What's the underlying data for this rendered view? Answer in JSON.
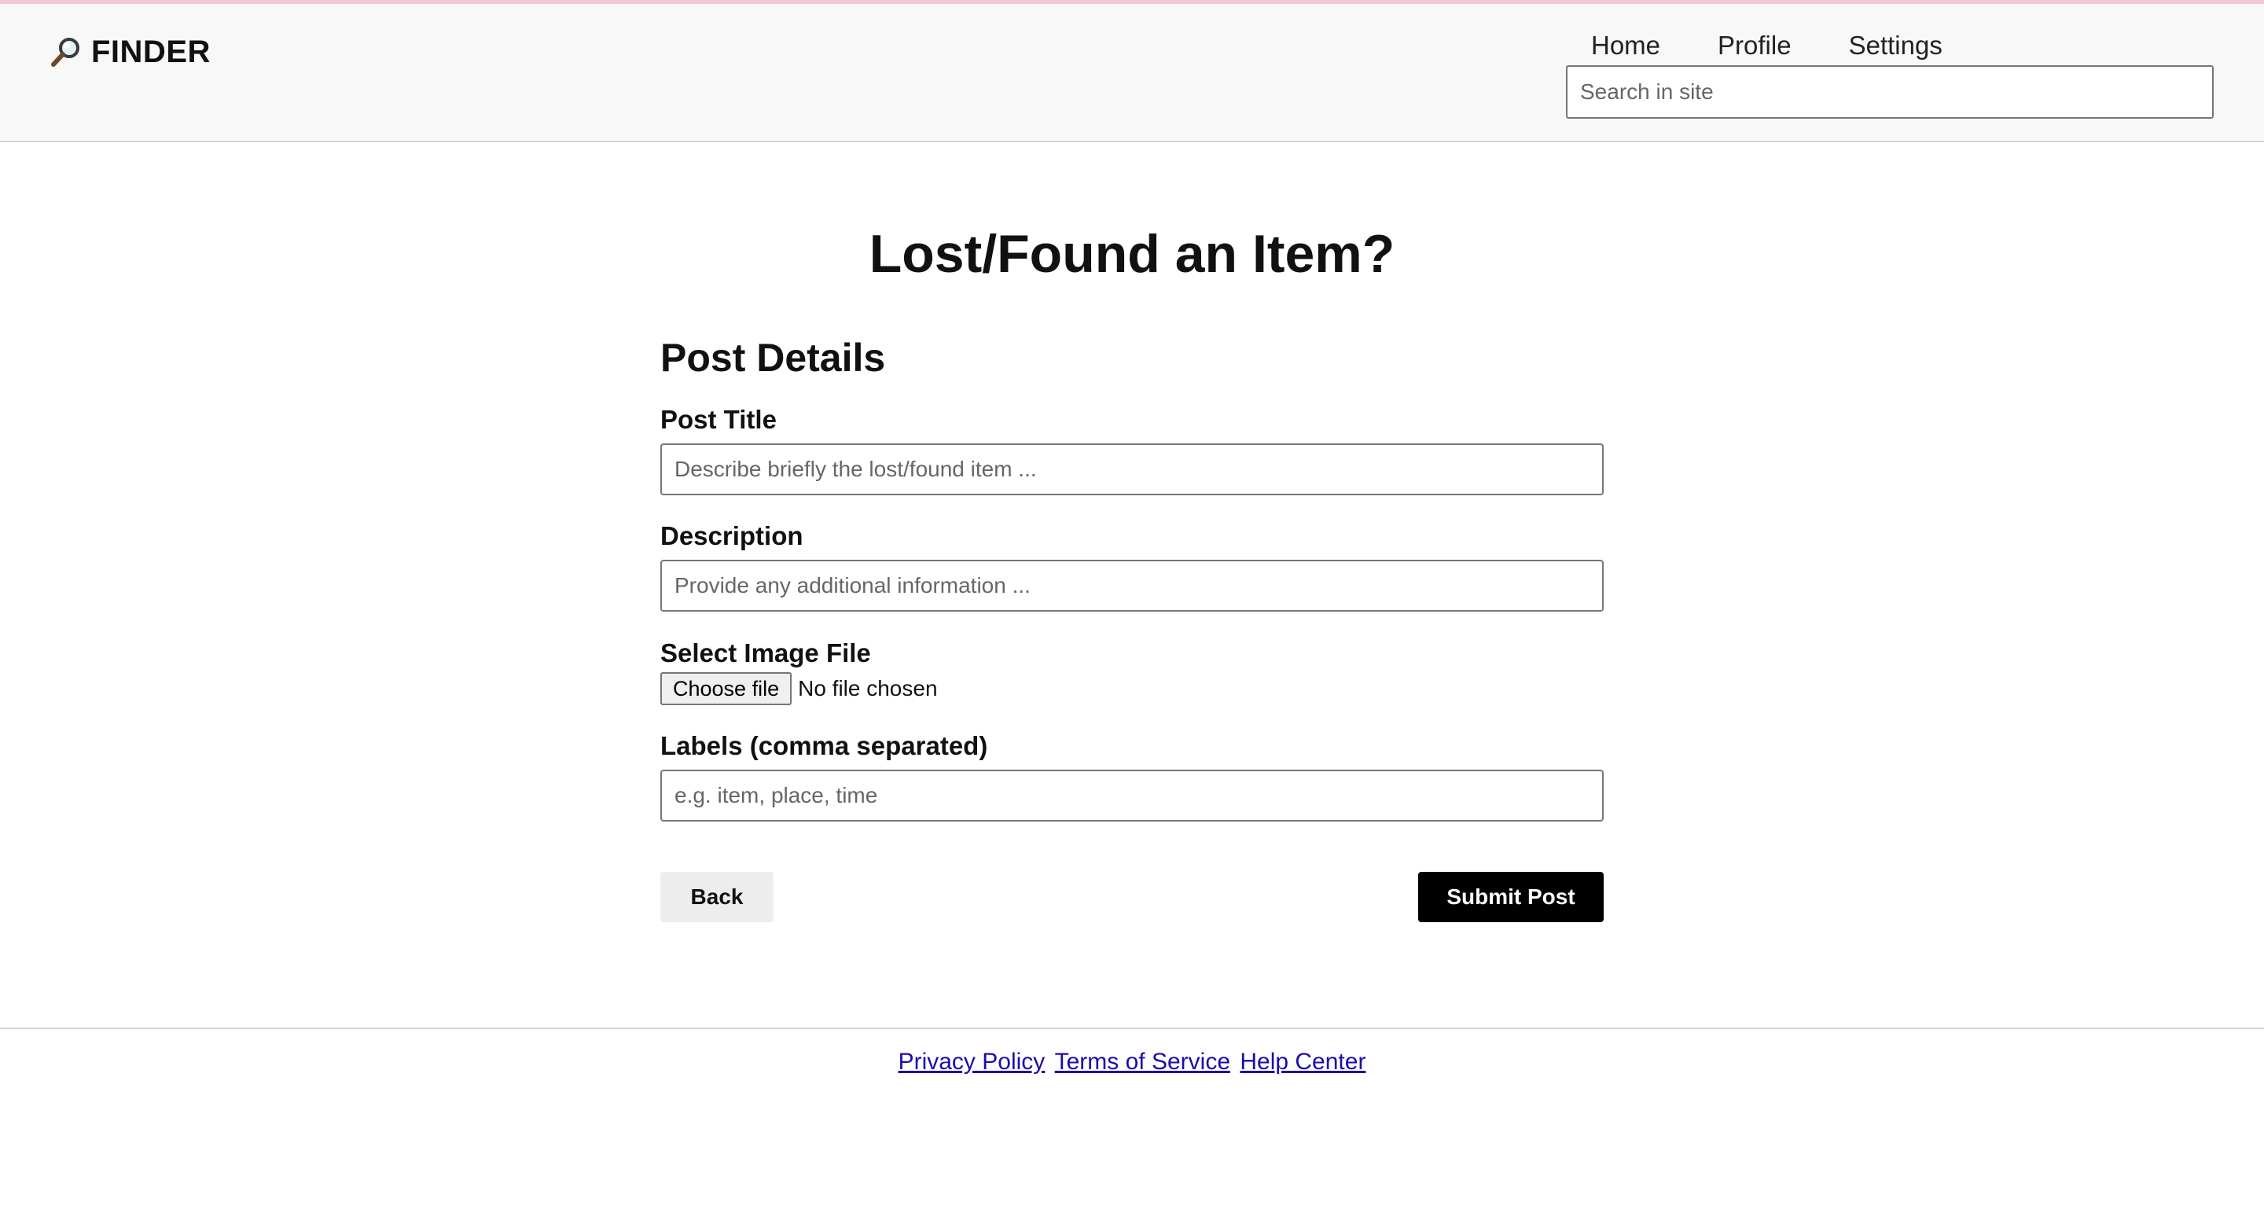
{
  "brand": {
    "name": "FINDER",
    "icon": "magnifier-icon"
  },
  "nav": {
    "items": [
      "Home",
      "Profile",
      "Settings"
    ]
  },
  "search": {
    "placeholder": "Search in site",
    "value": ""
  },
  "page": {
    "title": "Lost/Found an Item?"
  },
  "form": {
    "section_title": "Post Details",
    "post_title": {
      "label": "Post Title",
      "placeholder": "Describe briefly the lost/found item ...",
      "value": ""
    },
    "description": {
      "label": "Description",
      "placeholder": "Provide any additional information ...",
      "value": ""
    },
    "image": {
      "label": "Select Image File",
      "button": "Choose file",
      "status": "No file chosen"
    },
    "labels": {
      "label": "Labels (comma separated)",
      "placeholder": "e.g. item, place, time",
      "value": ""
    },
    "back_label": "Back",
    "submit_label": "Submit Post"
  },
  "footer": {
    "links": [
      "Privacy Policy",
      "Terms of Service",
      "Help Center"
    ],
    "link_color": "#1a0dab"
  },
  "colors": {
    "accent_bar": "#f4c7d6",
    "header_bg": "#f8f8f8",
    "submit_bg": "#000000",
    "back_bg": "#ededed"
  }
}
